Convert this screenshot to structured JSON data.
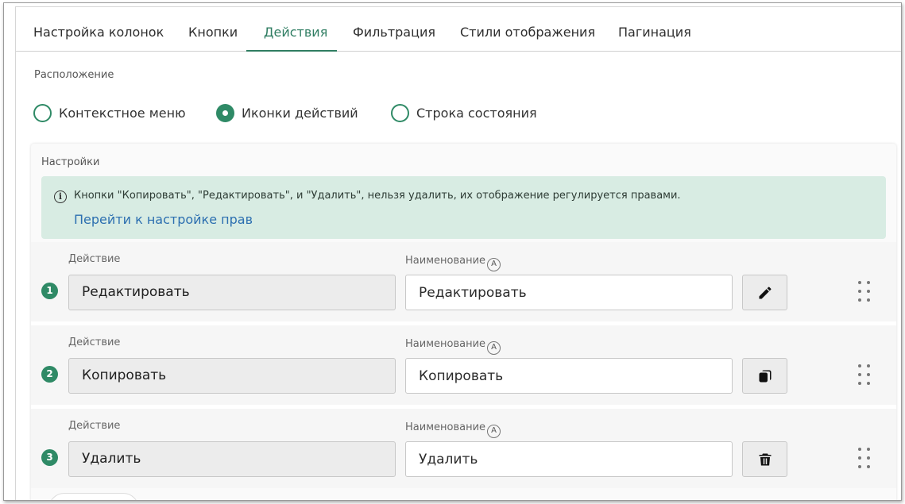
{
  "tabs": [
    {
      "label": "Настройка колонок"
    },
    {
      "label": "Кнопки"
    },
    {
      "label": "Действия"
    },
    {
      "label": "Фильтрация"
    },
    {
      "label": "Стили отображения"
    },
    {
      "label": "Пагинация"
    }
  ],
  "active_tab": "Действия",
  "placement": {
    "label": "Расположение",
    "options": [
      {
        "label": "Контекстное меню",
        "checked": false
      },
      {
        "label": "Иконки действий",
        "checked": true
      },
      {
        "label": "Строка состояния",
        "checked": false
      }
    ]
  },
  "settings": {
    "label": "Настройки",
    "alert": {
      "text": "Кнопки \"Копировать\", \"Редактировать\", и \"Удалить\", нельзя удалить, их отображение регулируется правами.",
      "link": "Перейти к настройке прав"
    },
    "action_label": "Действие",
    "name_label": "Наименование",
    "auto_badge": "A",
    "rows": [
      {
        "num": "1",
        "action": "Редактировать",
        "name": "Редактировать",
        "icon": "pencil-icon"
      },
      {
        "num": "2",
        "action": "Копировать",
        "name": "Копировать",
        "icon": "copy-icon"
      },
      {
        "num": "3",
        "action": "Удалить",
        "name": "Удалить",
        "icon": "trash-icon"
      }
    ]
  },
  "colors": {
    "accent": "#2f8a66",
    "alert_bg": "#d8ece3",
    "link": "#2c6fb0"
  }
}
